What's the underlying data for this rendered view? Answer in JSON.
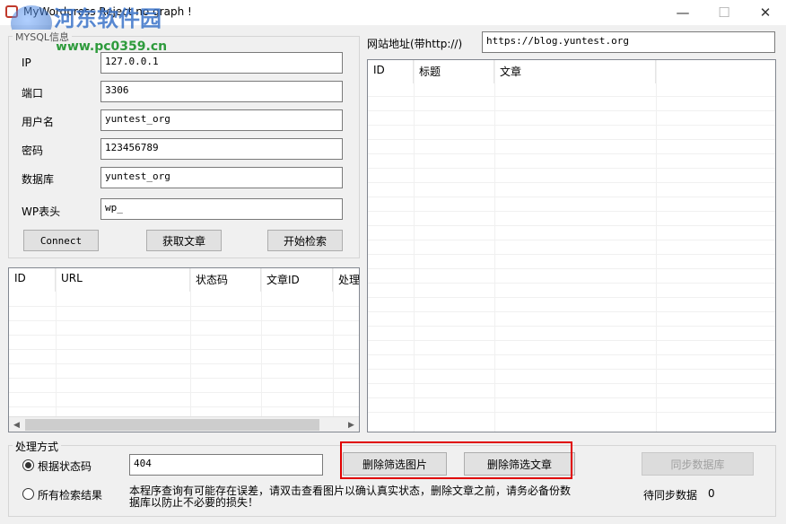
{
  "window": {
    "title": "MyWordpress Reject no graph !",
    "controls": {
      "minimize": "—",
      "maximize": "☐",
      "close": "✕"
    }
  },
  "watermark": {
    "site_name": "河东软件园",
    "url": "www.pc0359.cn"
  },
  "mysql": {
    "group_label": "MYSQL信息",
    "fields": [
      {
        "label": "IP",
        "value": "127.0.0.1"
      },
      {
        "label": "端口",
        "value": "3306"
      },
      {
        "label": "用户名",
        "value": "yuntest_org"
      },
      {
        "label": "密码",
        "value": "123456789"
      },
      {
        "label": "数据库",
        "value": "yuntest_org"
      },
      {
        "label": "WP表头",
        "value": "wp_"
      }
    ],
    "buttons": {
      "connect": "Connect",
      "get_articles": "获取文章",
      "start_search": "开始检索"
    }
  },
  "result_list": {
    "columns": [
      "ID",
      "URL",
      "状态码",
      "文章ID",
      "处理"
    ],
    "rows": []
  },
  "site": {
    "label": "网站地址(带http://)",
    "value": "https://blog.yuntest.org"
  },
  "article_list": {
    "columns": [
      "ID",
      "标题",
      "文章",
      ""
    ],
    "rows": []
  },
  "process": {
    "group_label": "处理方式",
    "options": [
      {
        "label": "根据状态码",
        "selected": true
      },
      {
        "label": "所有检索结果",
        "selected": false
      }
    ],
    "status_code_value": "404",
    "delete_images": "删除筛选图片",
    "delete_articles": "删除筛选文章",
    "sync_db": "同步数据库",
    "note": "本程序查询有可能存在误差，请双击查看图片以确认真实状态，删除文章之前，请务必备份数据库以防止不必要的损失！",
    "pending_label": "待同步数据",
    "pending_count": "0"
  }
}
